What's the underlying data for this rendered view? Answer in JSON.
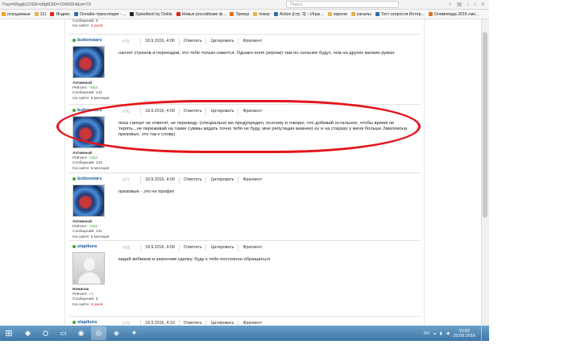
{
  "browser": {
    "url": "/?act=Msg&CODE=dfg6OID=1566054&st=70",
    "search_placeholder": "Поиск",
    "bookmarks": [
      {
        "label": "осещаемые",
        "icon": "star-icon",
        "color": "#f0a020"
      },
      {
        "label": "111",
        "icon": "folder-icon",
        "color": "#e2b44a"
      },
      {
        "label": "Яндекс",
        "icon": "yandex-icon",
        "color": "#e02020"
      },
      {
        "label": "Онлайн-трансляция - ...",
        "icon": "page-icon",
        "color": "#2a6ab0"
      },
      {
        "label": "Speedtest by Ookla",
        "icon": "speedtest-icon",
        "color": "#222"
      },
      {
        "label": "Новые российские ф...",
        "icon": "youtube-icon",
        "color": "#e02020"
      },
      {
        "label": "Трекер",
        "icon": "tracker-icon",
        "color": "#e07020"
      },
      {
        "label": "покер",
        "icon": "folder-icon",
        "color": "#e2b44a"
      },
      {
        "label": "Action [стр. 3] :: Игры...",
        "icon": "page-icon",
        "color": "#2a6ab0"
      },
      {
        "label": "пароли",
        "icon": "folder-icon",
        "color": "#e2b44a"
      },
      {
        "label": "каналы",
        "icon": "folder-icon",
        "color": "#e2b44a"
      },
      {
        "label": "Тест скорости Интер...",
        "icon": "page-icon",
        "color": "#2a6ab0"
      },
      {
        "label": "Олимпиада 2016 смо...",
        "icon": "page-icon",
        "color": "#e07020"
      }
    ]
  },
  "page": {
    "top_stats": "Сообщений: 3",
    "top_stats2": "На сайте: 6 дней"
  },
  "posts": [
    {
      "username": "buttonstars",
      "number": "#75",
      "date": "18.9.2016, 4:06",
      "reply": "Ответить",
      "quote": "Цитировать",
      "fragment": "Фрагмент",
      "rank": "Активный",
      "rating_label": "Рейтинг:",
      "rating": "+662",
      "messages": "Сообщений: 142",
      "online": "На сайте: 5 месяцев",
      "online_red": "",
      "avatar": "stars",
      "message": "насчет страхов и переездов, это тебе только кажется. Однако поля (игроки) там по сильнее будут, чем на других мелких румах"
    },
    {
      "username": "buttonstars",
      "number": "#76",
      "date": "18.9.2016, 4:09",
      "reply": "Ответить",
      "quote": "Цитировать",
      "fragment": "Фрагмент",
      "rank": "Активный",
      "rating_label": "Рейтинг:",
      "rating": "+662",
      "messages": "Сообщений: 142",
      "online": "На сайте: 5 месяцев",
      "online_red": "",
      "avatar": "stars",
      "message": "пока сапорт не ответит, не переведу. (специально же предупредил, поэтому и говорю, что добивай остальное, чтобы время не терять...не переживай на такие суммы кидать точно тебя не буду, мне репутация важнее) ну и на старзах у меня больше 2миллиона призовых, это так к слову)"
    },
    {
      "username": "buttonstars",
      "number": "#77",
      "date": "18.9.2016, 4:09",
      "reply": "Ответить",
      "quote": "Цитировать",
      "fragment": "Фрагмент",
      "rank": "Активный",
      "rating_label": "Рейтинг:",
      "rating": "+662",
      "messages": "Сообщений: 142",
      "online": "На сайте: 5 месяцев",
      "online_red": "",
      "avatar": "stars",
      "message": "призовые - это не профит"
    },
    {
      "username": "slapikura",
      "number": "#78",
      "date": "18.9.2016, 4:09",
      "reply": "Ответить",
      "quote": "Цитировать",
      "fragment": "Фрагмент",
      "rank": "Новичок",
      "rating_label": "Рейтинг:",
      "rating": "+1",
      "messages": "Сообщений: 3",
      "online": "На сайте: ",
      "online_red": "6 дней",
      "avatar": "blank",
      "message": "кидай вебмани и закончим сделку. буду к тебе постоянно обращаться"
    },
    {
      "username": "slapikura",
      "number": "#79",
      "date": "18.9.2016, 4:10",
      "reply": "Ответить",
      "quote": "Цитировать",
      "fragment": "Фрагмент",
      "rank": "",
      "rating_label": "",
      "rating": "",
      "messages": "",
      "online": "",
      "online_red": "",
      "avatar": "none",
      "message": ""
    }
  ],
  "taskbar": {
    "apps": [
      {
        "name": "start-button",
        "glyph": "⊞"
      },
      {
        "name": "app-green",
        "glyph": "◆"
      },
      {
        "name": "app-opera",
        "glyph": "O"
      },
      {
        "name": "app-folder",
        "glyph": "▭"
      },
      {
        "name": "app-chrome",
        "glyph": "◉"
      },
      {
        "name": "app-firefox",
        "glyph": "◎"
      },
      {
        "name": "app-shield",
        "glyph": "◈"
      },
      {
        "name": "app-tool",
        "glyph": "✦"
      }
    ],
    "lang": "RU",
    "time": "19:02",
    "date": "20.09.2016"
  }
}
